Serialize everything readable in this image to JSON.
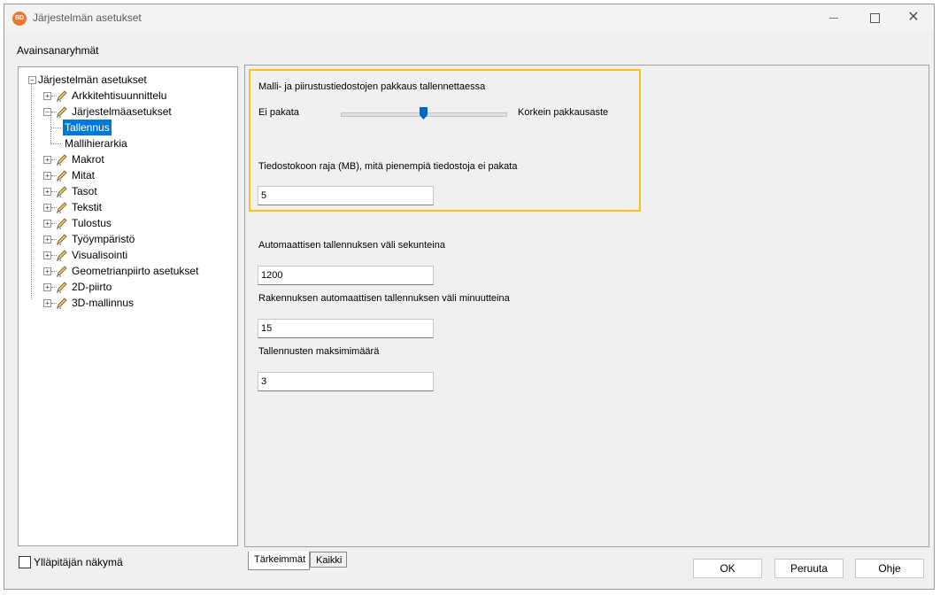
{
  "window": {
    "title": "Järjestelmän asetukset",
    "app_icon_text": "BD"
  },
  "section_label": "Avainsanaryhmät",
  "tree": {
    "root": "Järjestelmän asetukset",
    "items": [
      {
        "label": "Arkkitehtisuunnittelu"
      },
      {
        "label": "Järjestelmäasetukset"
      },
      {
        "label": "Tallennus"
      },
      {
        "label": "Mallihierarkia"
      },
      {
        "label": "Makrot"
      },
      {
        "label": "Mitat"
      },
      {
        "label": "Tasot"
      },
      {
        "label": "Tekstit"
      },
      {
        "label": "Tulostus"
      },
      {
        "label": "Työympäristö"
      },
      {
        "label": "Visualisointi"
      },
      {
        "label": "Geometrianpiirto asetukset"
      },
      {
        "label": "2D-piirto"
      },
      {
        "label": "3D-mallinnus"
      }
    ],
    "selected": "Tallennus"
  },
  "admin_view": {
    "label": "Ylläpitäjän näkymä",
    "checked": false
  },
  "settings": {
    "compression_label": "Malli- ja piirustustiedostojen pakkaus tallennettaessa",
    "slider_min_label": "Ei pakata",
    "slider_max_label": "Korkein pakkausaste",
    "slider_value": 0.5,
    "size_limit_label": "Tiedostokoon raja (MB), mitä pienempiä tiedostoja ei pakata",
    "size_limit_value": "5",
    "autosave_interval_label": "Automaattisen tallennuksen väli sekunteina",
    "autosave_interval_value": "1200",
    "building_autosave_label": "Rakennuksen automaattisen tallennuksen väli minuutteina",
    "building_autosave_value": "15",
    "max_saves_label": "Tallennusten maksimimäärä",
    "max_saves_value": "3"
  },
  "tabs": {
    "important": "Tärkeimmät",
    "all": "Kaikki"
  },
  "buttons": {
    "ok": "OK",
    "cancel": "Peruuta",
    "help": "Ohje"
  },
  "colors": {
    "selection": "#0078d7",
    "highlight": "#f7c21c",
    "slider_thumb": "#0067c0"
  }
}
